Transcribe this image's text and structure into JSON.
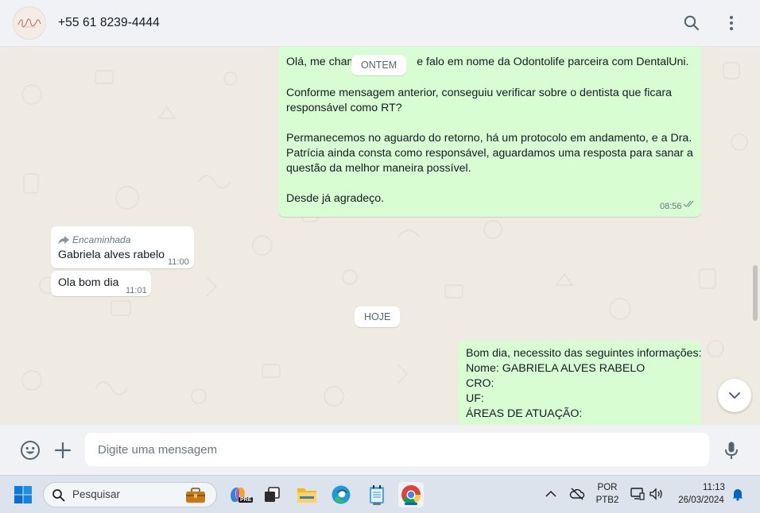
{
  "header": {
    "contact_name": "+55 61 8239-4444",
    "avatar_icon": "business-logo-avatar",
    "search_icon": "search-icon",
    "menu_icon": "kebab-menu-icon"
  },
  "messages": {
    "outgoing_1": {
      "line1": "Olá, me cham",
      "line1_rest": "e falo em nome da Odontolife parceira com DentalUni.",
      "para2_a": "Conforme mensagem anterior, conseguiu verificar sobre o dentista que ficara",
      "para2_b": "responsável como RT?",
      "para3_a": "Permanecemos no aguardo do retorno, há um protocolo em andamento, e a Dra.",
      "para3_b": "Patrícia ainda consta como responsável, aguardamos uma resposta para sanar a",
      "para3_b2": "questão da melhor maneira possível.",
      "para4": "Desde já agradeço.",
      "time": "08:56"
    },
    "incoming_1": {
      "forwarded_label": "Encaminhada",
      "text": "Gabriela alves rabelo",
      "time": "11:00"
    },
    "incoming_2": {
      "text": "Ola bom dia",
      "time": "11:01"
    },
    "outgoing_2": {
      "line1": "Bom dia, necessito das seguintes informações:",
      "line2": "Nome: GABRIELA ALVES RABELO",
      "line3": "CRO:",
      "line4": "UF:",
      "line5": "ÁREAS DE ATUAÇÃO:"
    }
  },
  "date_pills": {
    "yesterday": "ONTEM",
    "today": "HOJE"
  },
  "composer": {
    "placeholder": "Digite uma mensagem",
    "emoji_icon": "emoji-icon",
    "attach_icon": "plus-icon",
    "mic_icon": "microphone-icon"
  },
  "taskbar": {
    "search_placeholder": "Pesquisar",
    "language_line1": "POR",
    "language_line2": "PTB2",
    "time": "11:13",
    "date": "26/03/2024",
    "copilot_badge": "PRE"
  },
  "colors": {
    "outgoing_bubble": "#d9fdd3",
    "incoming_bubble": "#ffffff",
    "chat_background": "#efeae2",
    "read_ticks": "#8696a0"
  }
}
